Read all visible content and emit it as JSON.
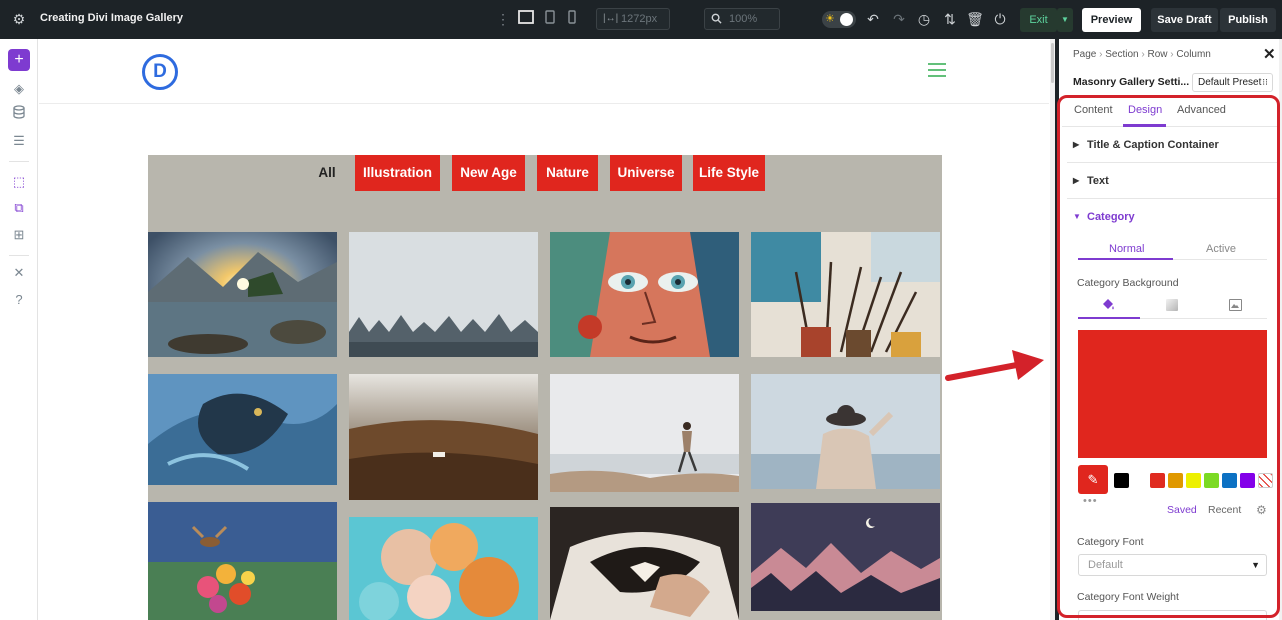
{
  "topbar": {
    "title": "Creating Divi Image Gallery",
    "width_value": "1272px",
    "zoom_value": "100%",
    "exit_label": "Exit",
    "preview_label": "Preview",
    "save_draft_label": "Save Draft",
    "publish_label": "Publish"
  },
  "gallery": {
    "categories": [
      "All",
      "Illustration",
      "New Age",
      "Nature",
      "Universe",
      "Life Style"
    ]
  },
  "panel": {
    "breadcrumb": [
      "Page",
      "Section",
      "Row",
      "Column"
    ],
    "module_title": "Masonry Gallery Setti...",
    "preset_label": "Default Preset",
    "tabs": [
      "Content",
      "Design",
      "Advanced"
    ],
    "sections": [
      "Title & Caption Container",
      "Text",
      "Category"
    ],
    "state_tabs": [
      "Normal",
      "Active"
    ],
    "category_background_label": "Category Background",
    "saved_label": "Saved",
    "recent_label": "Recent",
    "category_font_label": "Category Font",
    "category_font_value": "Default",
    "category_font_weight_label": "Category Font Weight"
  },
  "colors": {
    "accent": "#7e3bd0",
    "category_red": "#e0261e",
    "topbar_bg": "#1d2327",
    "highlight_frame": "#d3222a",
    "swatches": [
      "#000000",
      "#ffffff",
      "#e02b20",
      "#e09900",
      "#edf000",
      "#7cda24",
      "#0c71c3",
      "#8300e9"
    ]
  }
}
